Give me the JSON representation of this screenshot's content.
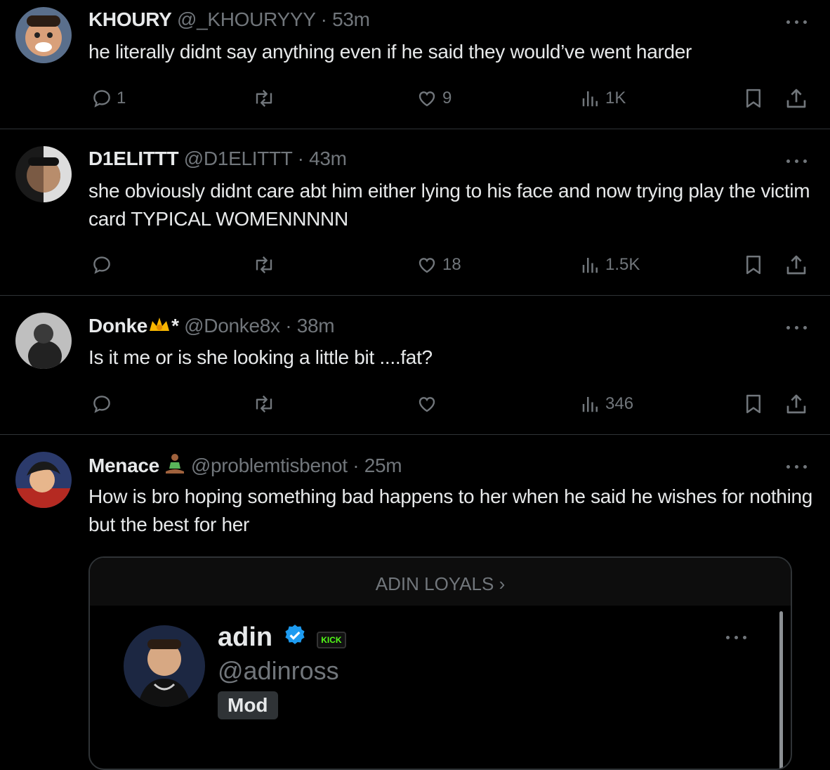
{
  "colors": {
    "background": "#000000",
    "text": "#e7e9ea",
    "muted": "#71767b",
    "divider": "#2f3336",
    "verified": "#1d9bf0",
    "kick": "#53fc18"
  },
  "tweets": [
    {
      "name": "KHOURY",
      "handle": "@_KHOURYYY",
      "time": "53m",
      "text": "he literally didnt say anything even if he said they would’ve went harder",
      "replies": "1",
      "retweets": "",
      "likes": "9",
      "views": "1K"
    },
    {
      "name": "D1ELITTT",
      "handle": "@D1ELITTT",
      "time": "43m",
      "text": "she obviously didnt care abt him either lying to his face and now trying play the victim card TYPICAL WOMENNNNN",
      "replies": "",
      "retweets": "",
      "likes": "18",
      "views": "1.5K"
    },
    {
      "name": "Donke",
      "name_suffix": "*",
      "handle": "@Donke8x",
      "time": "38m",
      "text": "Is it me or is she looking a little bit ....fat?",
      "replies": "",
      "retweets": "",
      "likes": "",
      "views": "346"
    },
    {
      "name": "Menace",
      "handle": "@problemtisbenot",
      "time": "25m",
      "text": "How is bro hoping something bad happens to her when he said he wishes for nothing but the best for her"
    }
  ],
  "card": {
    "community_label": "ADIN LOYALS ›",
    "name": "adin",
    "badge": "KICK",
    "handle": "@adinross",
    "role": "Mod"
  },
  "icons": {
    "reply": "reply-icon",
    "retweet": "retweet-icon",
    "like": "heart-icon",
    "views": "views-icon",
    "bookmark": "bookmark-icon",
    "share": "share-icon",
    "more": "more-icon"
  }
}
